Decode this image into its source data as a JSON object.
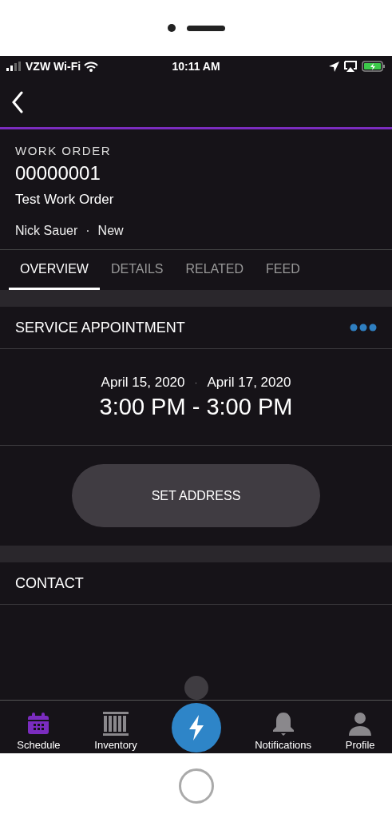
{
  "status_bar": {
    "carrier": "VZW Wi-Fi",
    "time": "10:11 AM"
  },
  "record": {
    "type_label": "WORK ORDER",
    "number": "00000001",
    "title": "Test Work Order",
    "owner": "Nick Sauer",
    "separator": "·",
    "status": "New"
  },
  "tabs": [
    {
      "label": "OVERVIEW",
      "selected": true
    },
    {
      "label": "DETAILS",
      "selected": false
    },
    {
      "label": "RELATED",
      "selected": false
    },
    {
      "label": "FEED",
      "selected": false
    }
  ],
  "service_appointment": {
    "title": "SERVICE APPOINTMENT",
    "start_date": "April 15, 2020",
    "date_separator": "·",
    "end_date": "April 17, 2020",
    "time_range": "3:00 PM - 3:00 PM",
    "button": "SET ADDRESS"
  },
  "contact": {
    "title": "CONTACT"
  },
  "tab_bar": [
    {
      "kind": "calendar",
      "label": "Schedule",
      "selected": true
    },
    {
      "kind": "inventory",
      "label": "Inventory",
      "selected": false
    },
    {
      "kind": "action",
      "selected": false
    },
    {
      "kind": "bell",
      "label": "Notifications",
      "selected": false
    },
    {
      "kind": "person",
      "label": "Profile",
      "selected": false
    }
  ]
}
